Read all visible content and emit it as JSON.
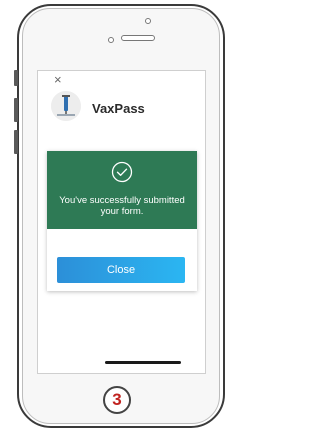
{
  "app": {
    "name": "VaxPass",
    "logo_icon": "vaccine-logo-icon"
  },
  "screen": {
    "close_symbol": "×"
  },
  "modal": {
    "message": "You've successfully submitted your form.",
    "close_label": "Close",
    "status_icon": "check-circle-icon",
    "banner_color": "#2e7a55",
    "button_color": "#2b9fe6"
  },
  "device": {
    "home_button_label": "3",
    "home_button_label_color": "#c0221f"
  }
}
